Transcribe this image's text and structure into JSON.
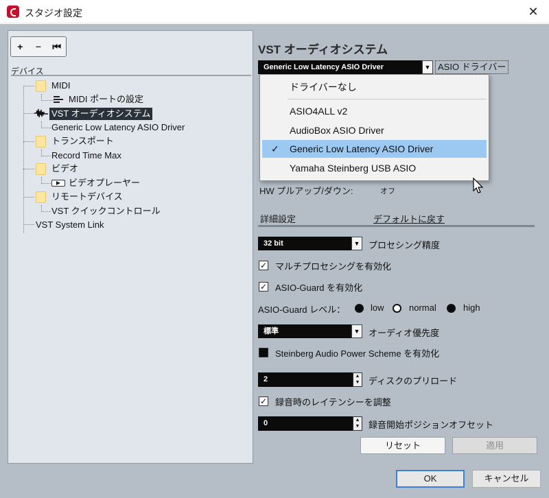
{
  "window": {
    "title": "スタジオ設定",
    "close_glyph": "✕"
  },
  "left_panel": {
    "toolbar": {
      "add": "+",
      "remove": "−",
      "reset": "⏮"
    },
    "header": "デバイス",
    "tree": {
      "midi": "MIDI",
      "midi_port": "MIDI ポートの設定",
      "vst_audio": "VST オーディオシステム",
      "generic_driver": "Generic Low Latency ASIO Driver",
      "transport": "トランスポート",
      "record_time": "Record Time Max",
      "video": "ビデオ",
      "video_player": "ビデオプレーヤー",
      "remote": "リモートデバイス",
      "quick_control": "VST クイックコントロール",
      "system_link": "VST System Link"
    }
  },
  "right_panel": {
    "title": "VST オーディオシステム",
    "asio_driver_value": "Generic Low Latency ASIO Driver",
    "asio_driver_label": "ASIO ドライバー",
    "dropdown_options": [
      {
        "label": "ドライバーなし",
        "selected": false
      },
      {
        "label": "ASIO4ALL v2",
        "selected": false
      },
      {
        "label": "AudioBox ASIO Driver",
        "selected": false
      },
      {
        "label": "Generic Low Latency ASIO Driver",
        "selected": true
      },
      {
        "label": "Yamaha Steinberg USB ASIO",
        "selected": false
      }
    ],
    "check_glyph": "✓",
    "hw_pullup_label": "HW プルアップ/ダウン:",
    "hw_pullup_value": "オフ",
    "details_label": "詳細設定",
    "reset_defaults": "デフォルトに戻す",
    "processing_precision_value": "32 bit",
    "processing_precision_label": "プロセシング精度",
    "multiprocessing": {
      "label": "マルチプロセシングを有効化",
      "checked": true
    },
    "asio_guard": {
      "label": "ASIO-Guard を有効化",
      "checked": true
    },
    "asio_guard_level": {
      "label": "ASIO-Guard レベル：",
      "options": [
        "low",
        "normal",
        "high"
      ],
      "selected": "normal"
    },
    "audio_priority_value": "標準",
    "audio_priority_label": "オーディオ優先度",
    "steinberg_power": {
      "label": "Steinberg Audio Power Scheme を有効化",
      "checked": false
    },
    "disk_preload_value": "2",
    "disk_preload_label": "ディスクのプリロード",
    "record_latency": {
      "label": "録音時のレイテンシーを調整",
      "checked": true
    },
    "record_offset_value": "0",
    "record_offset_label": "録音開始ポジションオフセット",
    "reset_button": "リセット",
    "apply_button": "適用"
  },
  "footer": {
    "ok": "OK",
    "cancel": "キャンセル"
  },
  "colors": {
    "accent": "#3c7fd4",
    "selection": "#9cc9f2",
    "panel_bg": "#b5bec7",
    "tree_bg": "#e1e6ec"
  }
}
